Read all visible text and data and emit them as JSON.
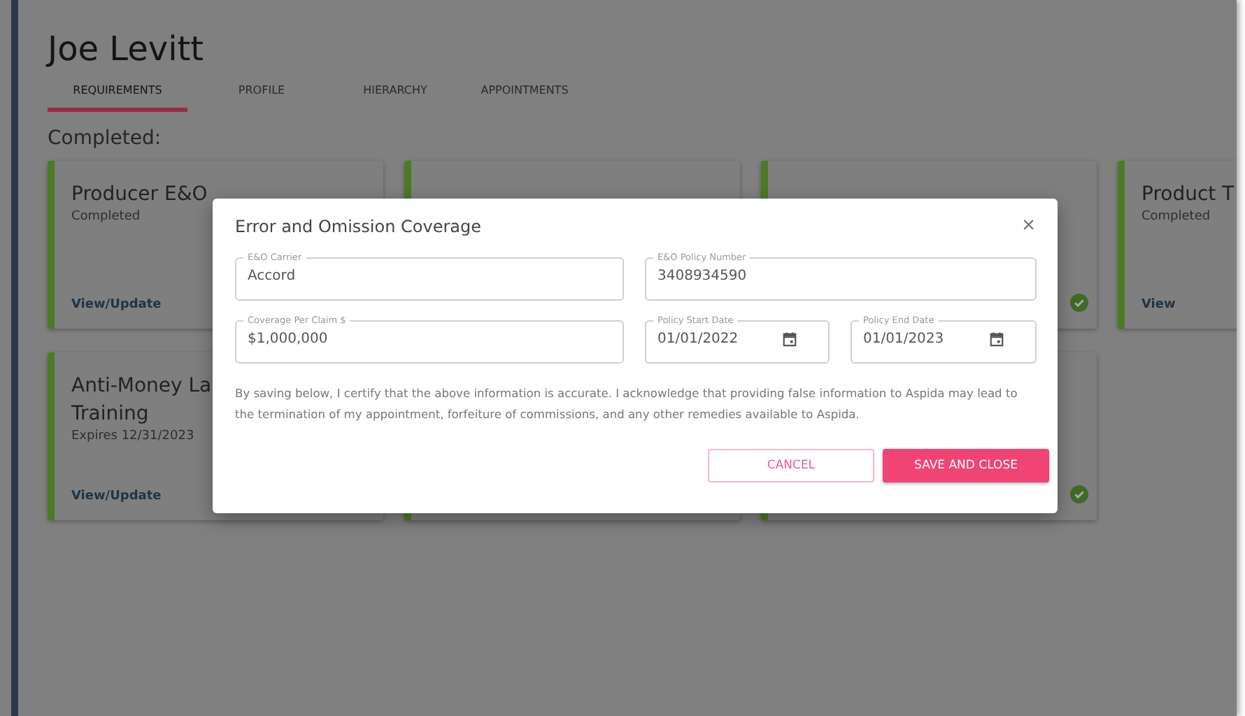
{
  "header": {
    "name": "Joe Levitt"
  },
  "tabs": [
    {
      "label": "REQUIREMENTS",
      "selected": true
    },
    {
      "label": "PROFILE",
      "selected": false
    },
    {
      "label": "HIERARCHY",
      "selected": false
    },
    {
      "label": "APPOINTMENTS",
      "selected": false
    }
  ],
  "section": {
    "heading": "Completed:"
  },
  "cards": [
    {
      "title_lines": [
        "Producer E&O"
      ],
      "subtitle": "Completed",
      "link": "View/Update",
      "check_mark": false
    },
    {
      "check_mark": false
    },
    {
      "check_mark": true
    },
    {
      "title_lines": [
        "Product T"
      ],
      "subtitle": "Completed",
      "link": "View",
      "check_mark": false
    },
    {
      "title_lines": [
        "Anti-Money La",
        "Training"
      ],
      "subtitle": "Expires 12/31/2023",
      "link": "View/Update",
      "check_mark": false
    },
    {
      "check_mark": false
    },
    {
      "check_mark": true
    }
  ],
  "dialog": {
    "title": "Error and Omission Coverage",
    "close": "×",
    "fields": [
      {
        "kind": "text",
        "label": "E&O Carrier",
        "value": "Accord"
      },
      {
        "kind": "text",
        "label": "E&O Policy Number",
        "value": "3408934590"
      },
      {
        "kind": "text",
        "label": "Coverage Per Claim $",
        "value": "$1,000,000"
      },
      {
        "kind": "date",
        "label": "Policy Start Date",
        "value": "01/01/2022"
      },
      {
        "kind": "date",
        "label": "Policy End Date",
        "value": "01/01/2023"
      }
    ],
    "notice": "By saving below, I certify that the above information is accurate. I acknowledge that providing false information to Aspida may lead to the termination of my appointment, forfeiture of commissions, and any other remedies available to Aspida.",
    "buttons": [
      {
        "kind": "secondary",
        "label": "CANCEL"
      },
      {
        "kind": "primary",
        "label": "SAVE AND CLOSE"
      }
    ]
  }
}
